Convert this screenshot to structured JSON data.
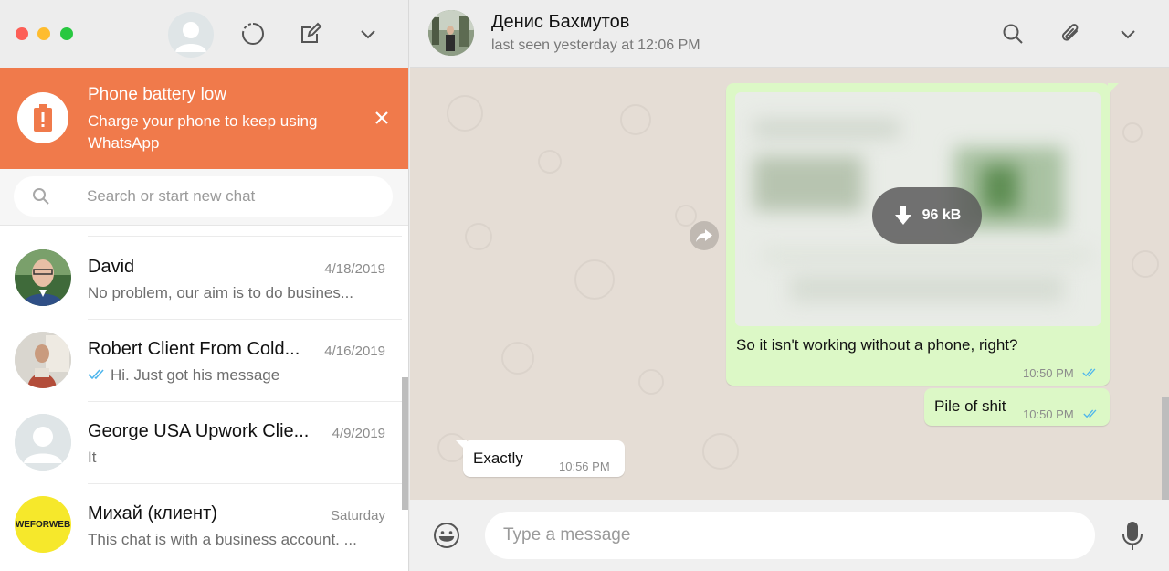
{
  "sidebar": {
    "battery_banner": {
      "title": "Phone battery low",
      "text": "Charge your phone to keep using WhatsApp"
    },
    "search": {
      "placeholder": "Search or start new chat"
    },
    "chats": [
      {
        "name": "David",
        "date": "4/18/2019",
        "preview": "No problem, our aim is to do busines..."
      },
      {
        "name": "Robert Client From Cold...",
        "date": "4/16/2019",
        "preview": "Hi. Just got his message"
      },
      {
        "name": "George USA Upwork Clie...",
        "date": "4/9/2019",
        "preview": "It"
      },
      {
        "name": "Михай (клиент)",
        "date": "Saturday",
        "preview": "This chat is with a business account. ...",
        "avatar_text": "WEFORWEB"
      }
    ]
  },
  "conversation": {
    "contact_name": "Денис Бахмутов",
    "contact_status": "last seen yesterday at 12:06 PM",
    "messages": [
      {
        "download_size": "96 kB",
        "text": "So it isn't working without a phone, right?",
        "time": "10:50 PM"
      },
      {
        "text": "Pile of shit",
        "time": "10:50 PM"
      },
      {
        "text": "Exactly",
        "time": "10:56 PM"
      }
    ],
    "composer": {
      "placeholder": "Type a message"
    }
  },
  "colors": {
    "banner": "#f07a4b",
    "outgoing_bubble": "#dcf8c6",
    "chat_background": "#e5ddd5",
    "read_ticks": "#4fb6ec"
  }
}
